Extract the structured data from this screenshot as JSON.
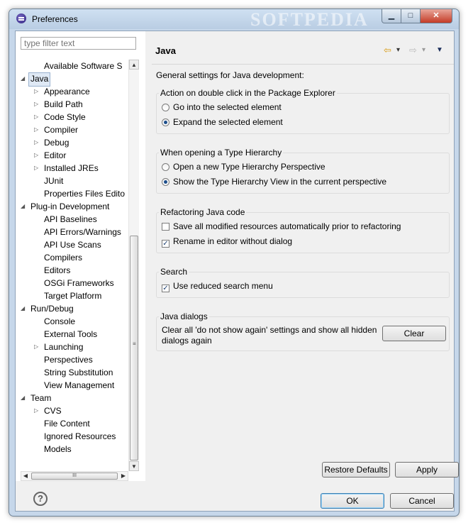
{
  "window": {
    "title": "Preferences",
    "watermark": "SOFTPEDIA",
    "min_glyph": "▁",
    "max_glyph": "□",
    "close_glyph": "✕"
  },
  "filter": {
    "placeholder": "type filter text"
  },
  "tree": [
    {
      "label": "Available Software S",
      "level": 2,
      "expander": "none"
    },
    {
      "label": "Java",
      "level": 1,
      "expander": "expanded",
      "selected": true
    },
    {
      "label": "Appearance",
      "level": 2,
      "expander": "collapsed"
    },
    {
      "label": "Build Path",
      "level": 2,
      "expander": "collapsed"
    },
    {
      "label": "Code Style",
      "level": 2,
      "expander": "collapsed"
    },
    {
      "label": "Compiler",
      "level": 2,
      "expander": "collapsed"
    },
    {
      "label": "Debug",
      "level": 2,
      "expander": "collapsed"
    },
    {
      "label": "Editor",
      "level": 2,
      "expander": "collapsed"
    },
    {
      "label": "Installed JREs",
      "level": 2,
      "expander": "collapsed"
    },
    {
      "label": "JUnit",
      "level": 2,
      "expander": "none"
    },
    {
      "label": "Properties Files Edito",
      "level": 2,
      "expander": "none"
    },
    {
      "label": "Plug-in Development",
      "level": 1,
      "expander": "expanded"
    },
    {
      "label": "API Baselines",
      "level": 2,
      "expander": "none"
    },
    {
      "label": "API Errors/Warnings",
      "level": 2,
      "expander": "none"
    },
    {
      "label": "API Use Scans",
      "level": 2,
      "expander": "none"
    },
    {
      "label": "Compilers",
      "level": 2,
      "expander": "none"
    },
    {
      "label": "Editors",
      "level": 2,
      "expander": "none"
    },
    {
      "label": "OSGi Frameworks",
      "level": 2,
      "expander": "none"
    },
    {
      "label": "Target Platform",
      "level": 2,
      "expander": "none"
    },
    {
      "label": "Run/Debug",
      "level": 1,
      "expander": "expanded"
    },
    {
      "label": "Console",
      "level": 2,
      "expander": "none"
    },
    {
      "label": "External Tools",
      "level": 2,
      "expander": "none"
    },
    {
      "label": "Launching",
      "level": 2,
      "expander": "collapsed"
    },
    {
      "label": "Perspectives",
      "level": 2,
      "expander": "none"
    },
    {
      "label": "String Substitution",
      "level": 2,
      "expander": "none"
    },
    {
      "label": "View Management",
      "level": 2,
      "expander": "none"
    },
    {
      "label": "Team",
      "level": 1,
      "expander": "expanded"
    },
    {
      "label": "CVS",
      "level": 2,
      "expander": "collapsed"
    },
    {
      "label": "File Content",
      "level": 2,
      "expander": "none"
    },
    {
      "label": "Ignored Resources",
      "level": 2,
      "expander": "none"
    },
    {
      "label": "Models",
      "level": 2,
      "expander": "none"
    }
  ],
  "scroll": {
    "up": "▲",
    "down": "▼",
    "left": "◀",
    "right": "▶",
    "grip": "≡",
    "hgrip": "III"
  },
  "page": {
    "title": "Java",
    "nav": {
      "back": "⇦",
      "back_menu": "▾",
      "forward": "⇨",
      "forward_menu": "▾",
      "view_menu": "▼"
    },
    "description": "General settings for Java development:",
    "groups": {
      "double_click": {
        "title": "Action on double click in the Package Explorer",
        "options": [
          {
            "label": "Go into the selected element",
            "selected": false
          },
          {
            "label": "Expand the selected element",
            "selected": true
          }
        ]
      },
      "type_hierarchy": {
        "title": "When opening a Type Hierarchy",
        "options": [
          {
            "label": "Open a new Type Hierarchy Perspective",
            "selected": false
          },
          {
            "label": "Show the Type Hierarchy View in the current perspective",
            "selected": true
          }
        ]
      },
      "refactoring": {
        "title": "Refactoring Java code",
        "options": [
          {
            "label": "Save all modified resources automatically prior to refactoring",
            "checked": false
          },
          {
            "label": "Rename in editor without dialog",
            "checked": true
          }
        ]
      },
      "search": {
        "title": "Search",
        "options": [
          {
            "label": "Use reduced search menu",
            "checked": true
          }
        ]
      },
      "dialogs": {
        "title": "Java dialogs",
        "text_line1": "Clear all 'do not show again' settings and show all hidden",
        "text_line2": "dialogs again",
        "clear_label": "Clear"
      }
    },
    "restore_defaults_label": "Restore Defaults",
    "apply_label": "Apply"
  },
  "footer": {
    "help_glyph": "?",
    "ok_label": "OK",
    "cancel_label": "Cancel"
  }
}
